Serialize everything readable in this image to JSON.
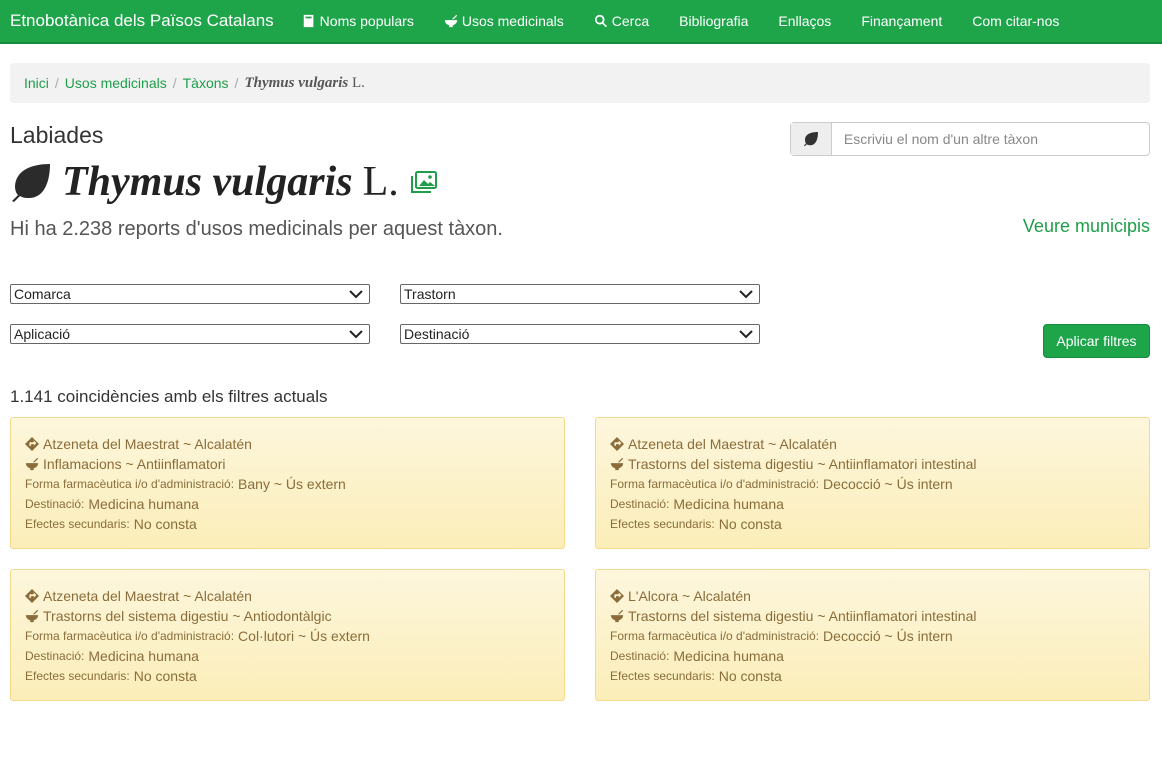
{
  "navbar": {
    "brand": "Etnobotànica dels Països Catalans",
    "items": [
      {
        "label": "Noms populars",
        "icon": "book-icon"
      },
      {
        "label": "Usos medicinals",
        "icon": "mortar-icon"
      },
      {
        "label": "Cerca",
        "icon": "search-icon"
      },
      {
        "label": "Bibliografia"
      },
      {
        "label": "Enllaços"
      },
      {
        "label": "Finançament"
      },
      {
        "label": "Com citar-nos"
      }
    ]
  },
  "breadcrumb": {
    "items": [
      "Inici",
      "Usos medicinals",
      "Tàxons"
    ],
    "current_genus_species": "Thymus vulgaris",
    "current_author": "L."
  },
  "taxon": {
    "family": "Labiades",
    "name": "Thymus vulgaris",
    "author": "L.",
    "reports_text": "Hi ha 2.238 reports d'usos medicinals per aquest tàxon.",
    "see_municipis": "Veure municipis"
  },
  "search": {
    "placeholder": "Escriviu el nom d'un altre tàxon",
    "icon": "leaf-icon"
  },
  "filters": {
    "comarca": "Comarca",
    "trastorn": "Trastorn",
    "aplicacio": "Aplicació",
    "destinacio": "Destinació",
    "apply": "Aplicar filtres"
  },
  "matches_text": "1.141 coincidències amb els filtres actuals",
  "labels": {
    "forma": "Forma farmacèutica i/o d'administració:",
    "destinacio": "Destinació:",
    "efectes": "Efectes secundaris:"
  },
  "cards": [
    {
      "location": "Atzeneta del Maestrat ~ Alcalatén",
      "disorder": "Inflamacions ~ Antiinflamatori",
      "forma": "Bany ~ Ús extern",
      "destinacio": "Medicina humana",
      "efectes": "No consta"
    },
    {
      "location": "Atzeneta del Maestrat ~ Alcalatén",
      "disorder": "Trastorns del sistema digestiu ~ Antiinflamatori intestinal",
      "forma": "Decocció ~ Ús intern",
      "destinacio": "Medicina humana",
      "efectes": "No consta"
    },
    {
      "location": "Atzeneta del Maestrat ~ Alcalatén",
      "disorder": "Trastorns del sistema digestiu ~ Antiodontàlgic",
      "forma": "Col·lutori ~ Ús extern",
      "destinacio": "Medicina humana",
      "efectes": "No consta"
    },
    {
      "location": "L'Alcora ~ Alcalatén",
      "disorder": "Trastorns del sistema digestiu ~ Antiinflamatori intestinal",
      "forma": "Decocció ~ Ús intern",
      "destinacio": "Medicina humana",
      "efectes": "No consta"
    }
  ],
  "colors": {
    "brand_green": "#1ea54a",
    "card_bg": "#fdf6dc",
    "card_text": "#8a6d3b"
  }
}
